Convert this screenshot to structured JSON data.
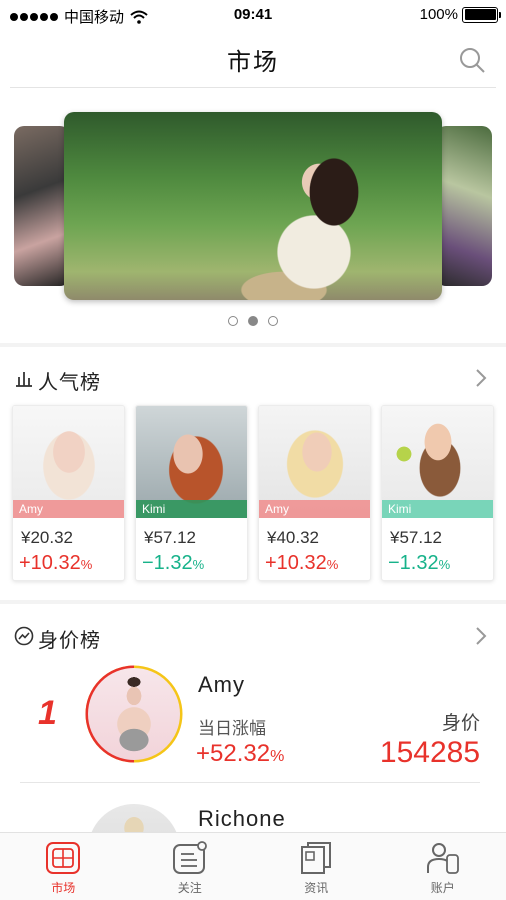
{
  "status_bar": {
    "carrier": "中国移动",
    "time": "09:41",
    "battery": "100%",
    "battery_level": 1.0
  },
  "nav": {
    "title": "市场",
    "search_icon": "search-icon"
  },
  "banner": {
    "slide_count": 3,
    "active_index": 1
  },
  "popularity": {
    "title": "人气榜",
    "icon": "bar-chart-icon",
    "cards": [
      {
        "name": "Amy",
        "price": "¥20.32",
        "change": "+10.32",
        "unit": "%",
        "direction": "up",
        "tag_color": "#f08c8c"
      },
      {
        "name": "Kimi",
        "price": "¥57.12",
        "change": "−1.32",
        "unit": "%",
        "direction": "down",
        "tag_color": "#3fae6e"
      },
      {
        "name": "Amy",
        "price": "¥40.32",
        "change": "+10.32",
        "unit": "%",
        "direction": "up",
        "tag_color": "#f08c8c"
      },
      {
        "name": "Kimi",
        "price": "¥57.12",
        "change": "−1.32",
        "unit": "%",
        "direction": "down",
        "tag_color": "#6dd3b4"
      }
    ]
  },
  "value_rank": {
    "title": "身价榜",
    "icon": "trend-icon",
    "items": [
      {
        "rank": "1",
        "name": "Amy",
        "change_label": "当日涨幅",
        "change": "+52.32",
        "unit": "%",
        "value_label": "身价",
        "value": "154285"
      },
      {
        "name": "Richone"
      }
    ]
  },
  "tabbar": {
    "tabs": [
      {
        "label": "市场",
        "icon": "market-icon",
        "active": true
      },
      {
        "label": "关注",
        "icon": "follow-icon",
        "active": false
      },
      {
        "label": "资讯",
        "icon": "news-icon",
        "active": false
      },
      {
        "label": "账户",
        "icon": "account-icon",
        "active": false
      }
    ]
  },
  "colors": {
    "accent_up": "#e8322b",
    "accent_down": "#17b28a"
  }
}
